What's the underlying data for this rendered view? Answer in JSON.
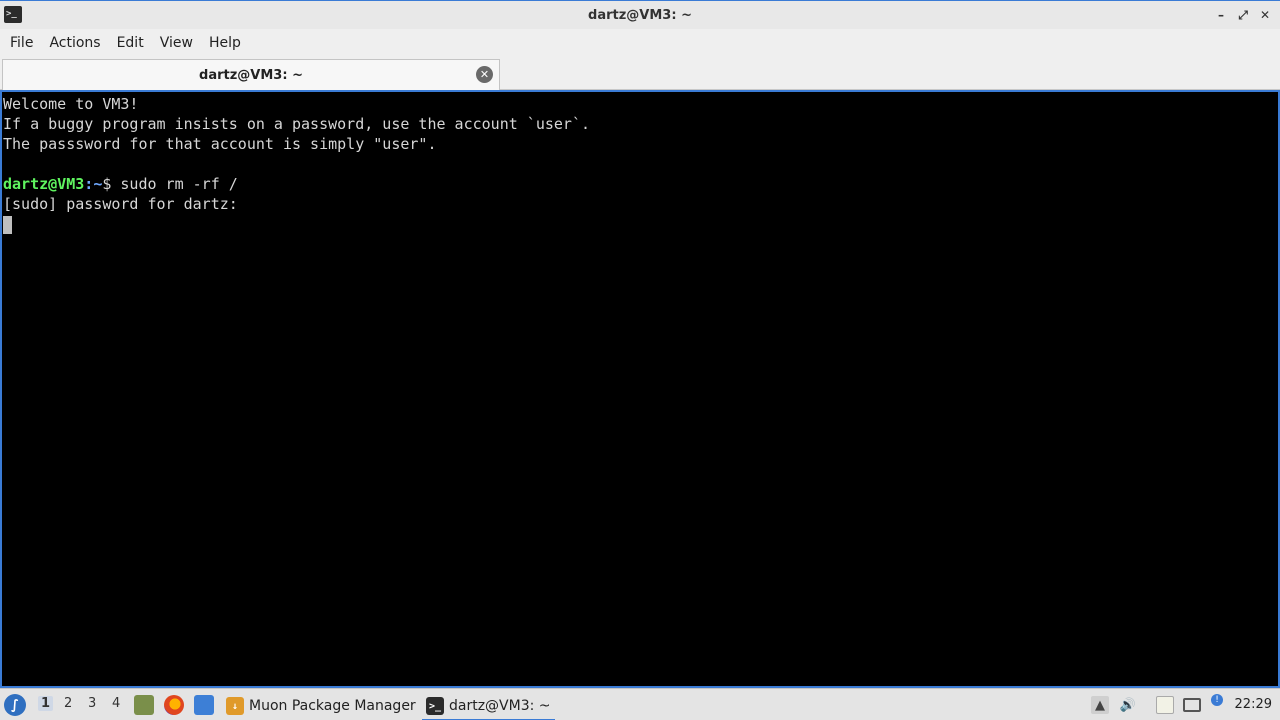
{
  "window": {
    "title": "dartz@VM3: ~",
    "icon": "terminal-icon",
    "controls": {
      "minimize": "–",
      "restore": "⤢",
      "close": "✕"
    }
  },
  "menu": [
    "File",
    "Actions",
    "Edit",
    "View",
    "Help"
  ],
  "tab": {
    "label": "dartz@VM3: ~",
    "close_glyph": "✕"
  },
  "terminal": {
    "lines": [
      "Welcome to VM3!",
      "If a buggy program insists on a password, use the account `user`.",
      "The passsword for that account is simply \"user\".",
      ""
    ],
    "prompt": {
      "user_host": "dartz@VM3",
      "sep": ":",
      "path": "~",
      "symbol": "$",
      "command": " sudo rm -rf /"
    },
    "sudo_line": "[sudo] password for dartz:"
  },
  "taskbar": {
    "start_icon": "lxqt-start-icon",
    "desktops": [
      "1",
      "2",
      "3",
      "4"
    ],
    "active_desktop": "1",
    "quick_launch": [
      "file-manager-icon",
      "firefox-icon",
      "show-desktop-icon"
    ],
    "tasks": [
      {
        "label": "Muon Package Manager",
        "icon": "package-manager-icon"
      },
      {
        "label": "dartz@VM3: ~",
        "icon": "terminal-icon"
      }
    ],
    "tray": [
      "tray-up-icon",
      "volume-icon",
      "clipboard-icon",
      "monitor-icon",
      "update-notifier-icon"
    ],
    "clock": "22:29"
  },
  "colors": {
    "accent": "#3a7bd5",
    "prompt_user": "#5ff45f",
    "prompt_path": "#6fa8ff",
    "terminal_bg": "#000000",
    "terminal_fg": "#d6d6d6"
  }
}
